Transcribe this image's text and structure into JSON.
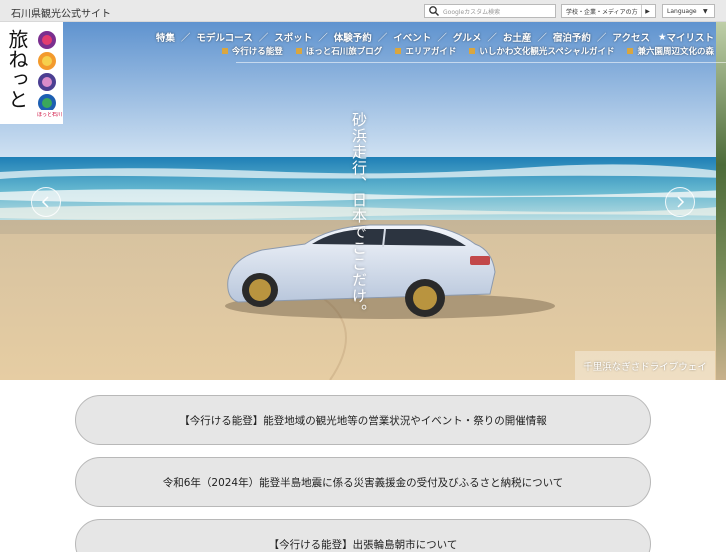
{
  "topbar": {
    "site_tag": "石川県観光公式サイト",
    "search_placeholder": "Googleカスタム検索",
    "target_select": "学校・企業・メディアの方",
    "language_select": "Language"
  },
  "logo": {
    "text": "旅ねっと",
    "sub": "ほっと石川"
  },
  "nav": {
    "primary": [
      "特集",
      "モデルコース",
      "スポット",
      "体験予約",
      "イベント",
      "グルメ",
      "お土産",
      "宿泊予約",
      "アクセス"
    ],
    "mylist": "マイリスト",
    "secondary": [
      "今行ける能登",
      "ほっと石川旅ブログ",
      "エリアガイド",
      "いしかわ文化観光スペシャルガイド",
      "兼六園周辺文化の森"
    ]
  },
  "hero": {
    "catch": "砂浜走行、日本でここだけ。",
    "caption": "千里浜なぎさドライブウェイ"
  },
  "notices": [
    "【今行ける能登】能登地域の観光地等の営業状況やイベント・祭りの開催情報",
    "令和6年（2024年）能登半島地震に係る災害義援金の受付及びふるさと納税について",
    "【今行ける能登】出張輪島朝市について"
  ],
  "colors": {
    "topbar_bg": "#e9e9e9",
    "notice_bg": "#e6e6e6",
    "nav_bullet": "#d9a640"
  }
}
